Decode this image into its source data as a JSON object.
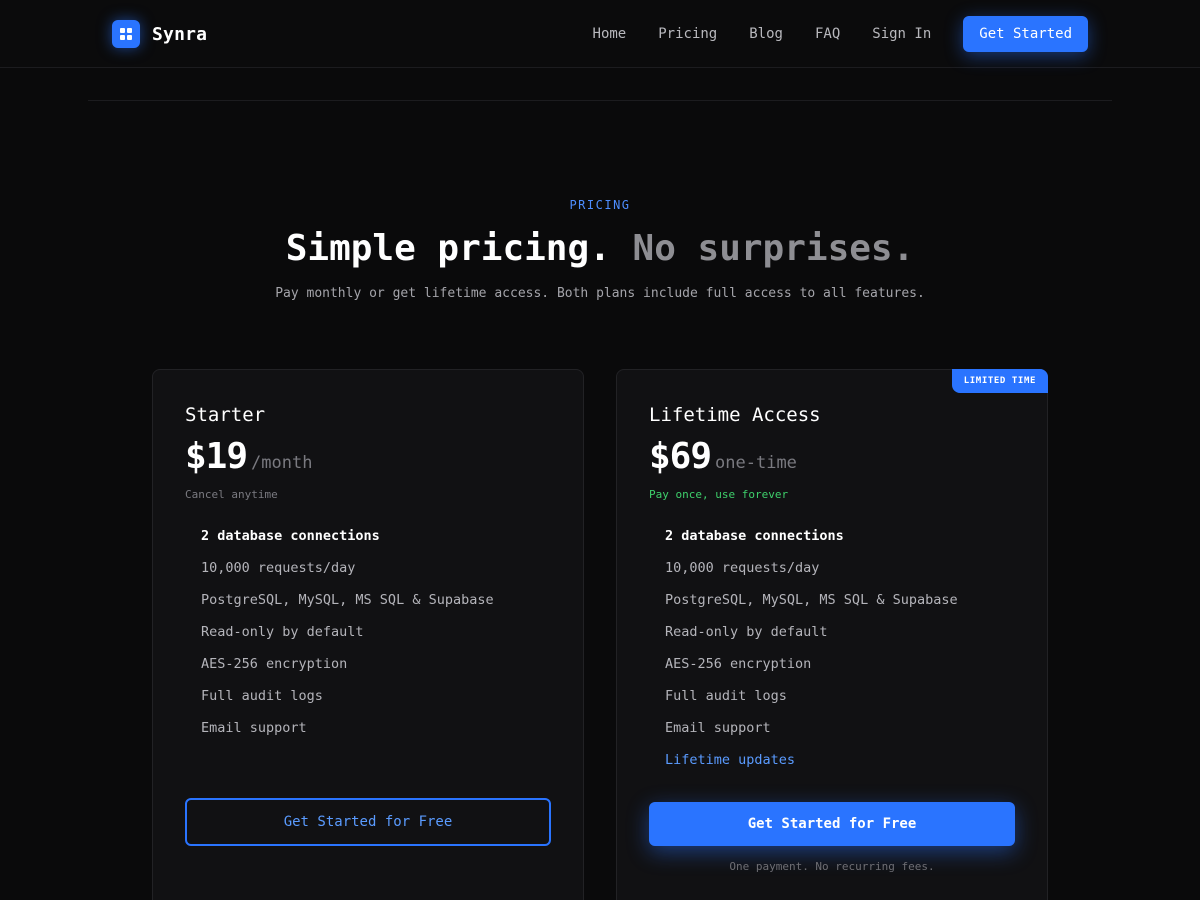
{
  "nav": {
    "brand": "Synra",
    "links": [
      "Home",
      "Pricing",
      "Blog",
      "FAQ",
      "Sign In"
    ],
    "cta": "Get Started"
  },
  "hero": {
    "eyebrow": "PRICING",
    "headline_main": "Simple pricing.",
    "headline_muted": "No surprises.",
    "subhead": "Pay monthly or get lifetime access. Both plans include full access to all features."
  },
  "plans": [
    {
      "name": "Starter",
      "price": "$19",
      "period": "/month",
      "note": "Cancel anytime",
      "features": [
        "2 database connections",
        "10,000 requests/day",
        "PostgreSQL, MySQL, MS SQL & Supabase",
        "Read-only by default",
        "AES-256 encryption",
        "Full audit logs",
        "Email support"
      ],
      "cta": "Get Started for Free"
    },
    {
      "name": "Lifetime Access",
      "badge": "LIMITED TIME",
      "price": "$69",
      "period": "one-time",
      "note": "Pay once, use forever",
      "features": [
        "2 database connections",
        "10,000 requests/day",
        "PostgreSQL, MySQL, MS SQL & Supabase",
        "Read-only by default",
        "AES-256 encryption",
        "Full audit logs",
        "Email support",
        "Lifetime updates"
      ],
      "cta": "Get Started for Free",
      "footnote": "One payment. No recurring fees."
    }
  ],
  "colors": {
    "background": "#0a0a0b",
    "accent": "#2a74ff",
    "success": "#3ecf6b"
  }
}
